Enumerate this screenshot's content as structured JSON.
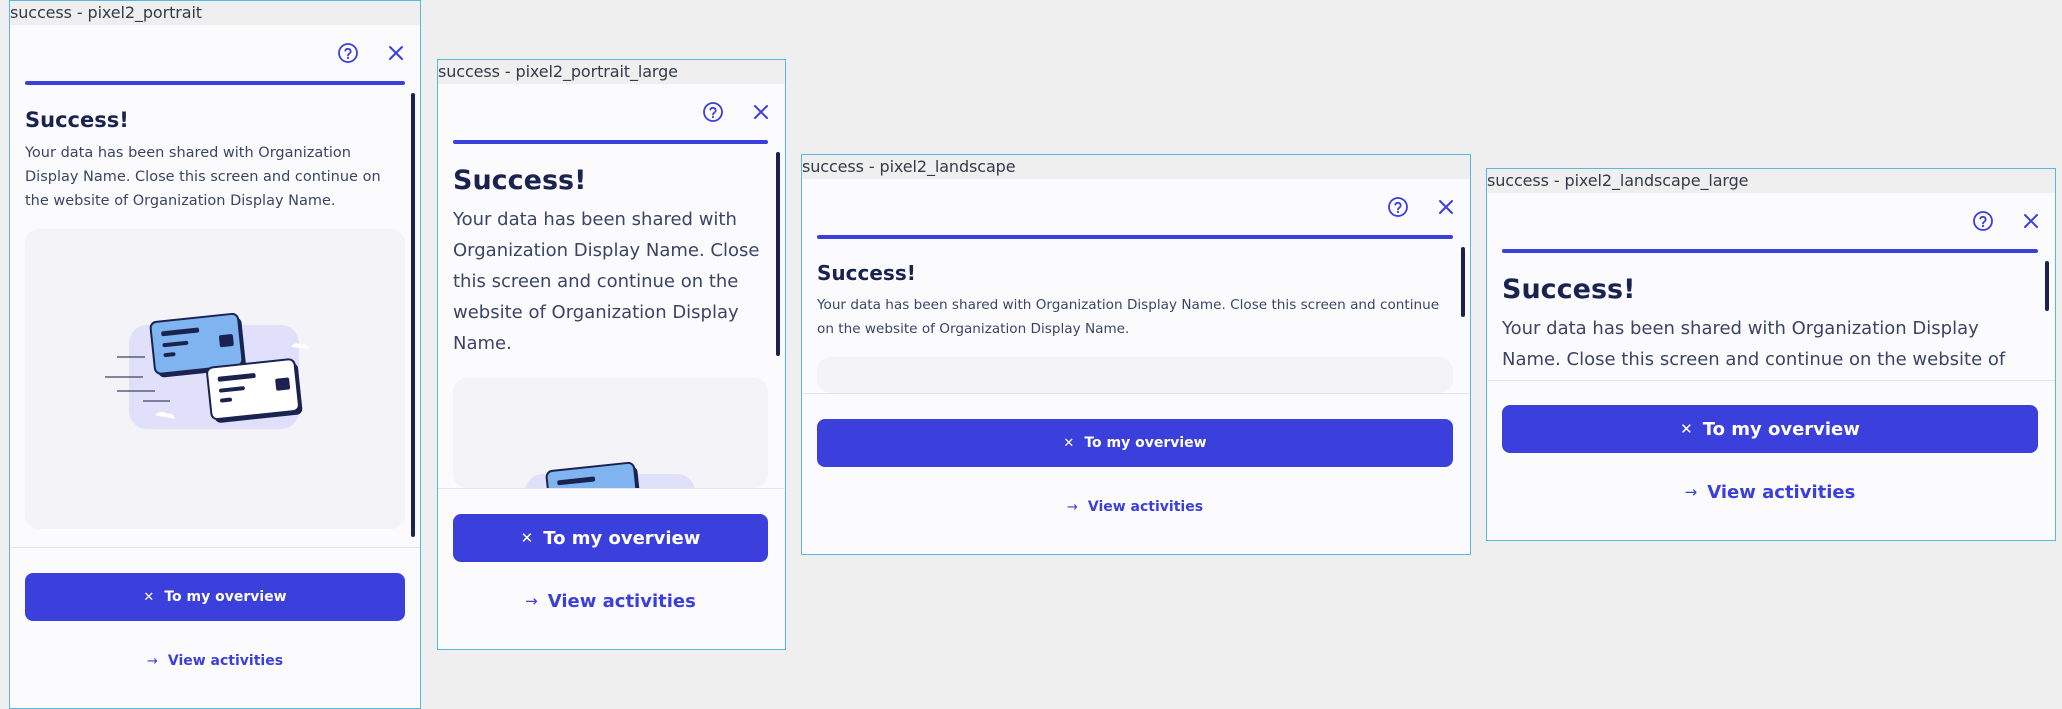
{
  "frames": [
    {
      "label": "success - pixel2_portrait"
    },
    {
      "label": "success - pixel2_portrait_large"
    },
    {
      "label": "success - pixel2_landscape"
    },
    {
      "label": "success - pixel2_landscape_large"
    }
  ],
  "dialog": {
    "title": "Success!",
    "message": "Your data has been shared with Organization Display Name. Close this screen and continue on the website of Organization Display Name.",
    "message_clipped": "Your data has been shared with Organization Display Name. Close this screen and continue on the website of",
    "primary_label": "To my overview",
    "secondary_label": "View activities",
    "close_glyph": "✕",
    "arrow_glyph": "→",
    "help_icon": "help-circle-icon",
    "close_icon": "close-icon"
  },
  "colors": {
    "accent": "#3b3fdb",
    "title": "#1a2350",
    "frame_border": "#58b9e0"
  }
}
